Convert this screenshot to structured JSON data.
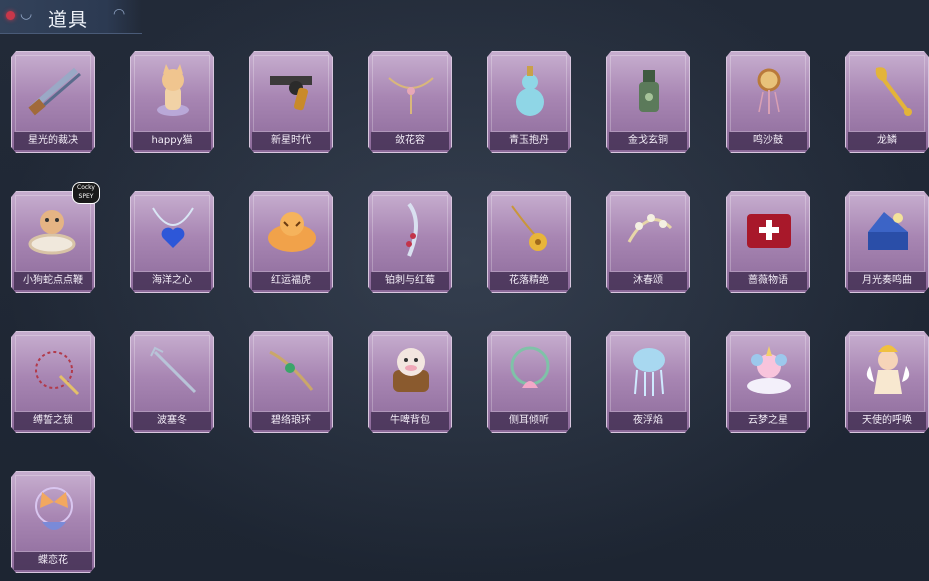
{
  "header": {
    "title": "道具"
  },
  "items": [
    {
      "label": "星光的裁决",
      "icon": "double-barrel-gun-icon"
    },
    {
      "label": "happy猫",
      "icon": "cat-figurine-icon"
    },
    {
      "label": "新星时代",
      "icon": "revolver-icon"
    },
    {
      "label": "敛花容",
      "icon": "flower-chain-icon"
    },
    {
      "label": "青玉抱丹",
      "icon": "jade-gourd-icon"
    },
    {
      "label": "金戈玄铜",
      "icon": "bronze-grenade-icon"
    },
    {
      "label": "鸣沙鼓",
      "icon": "sand-drum-icon"
    },
    {
      "label": "龙鳞",
      "icon": "golden-spade-icon"
    },
    {
      "label": "小狗蛇点点鞭",
      "icon": "puppy-snake-whip-icon"
    },
    {
      "label": "海洋之心",
      "icon": "heart-necklace-icon"
    },
    {
      "label": "红运福虎",
      "icon": "lucky-tiger-icon"
    },
    {
      "label": "铂刺与红莓",
      "icon": "silver-thorn-blade-icon"
    },
    {
      "label": "花落精绝",
      "icon": "golden-flower-chain-icon"
    },
    {
      "label": "沐春颂",
      "icon": "spring-flower-bow-icon"
    },
    {
      "label": "蔷薇物语",
      "icon": "first-aid-box-icon"
    },
    {
      "label": "月光奏鸣曲",
      "icon": "music-box-icon"
    },
    {
      "label": "缚誓之锁",
      "icon": "vow-chain-icon"
    },
    {
      "label": "波塞冬",
      "icon": "trident-icon"
    },
    {
      "label": "碧络琅环",
      "icon": "jade-ring-blade-icon"
    },
    {
      "label": "牛啤背包",
      "icon": "cow-barrel-backpack-icon"
    },
    {
      "label": "侧耳倾听",
      "icon": "lotus-wreath-icon"
    },
    {
      "label": "夜浮焰",
      "icon": "blue-jellyfish-icon"
    },
    {
      "label": "云梦之星",
      "icon": "unicorn-cloud-icon"
    },
    {
      "label": "天使的呼唤",
      "icon": "angel-doll-icon"
    },
    {
      "label": "蝶恋花",
      "icon": "butterfly-lantern-icon"
    }
  ],
  "sticker": {
    "text": "Cocky SPEY"
  }
}
